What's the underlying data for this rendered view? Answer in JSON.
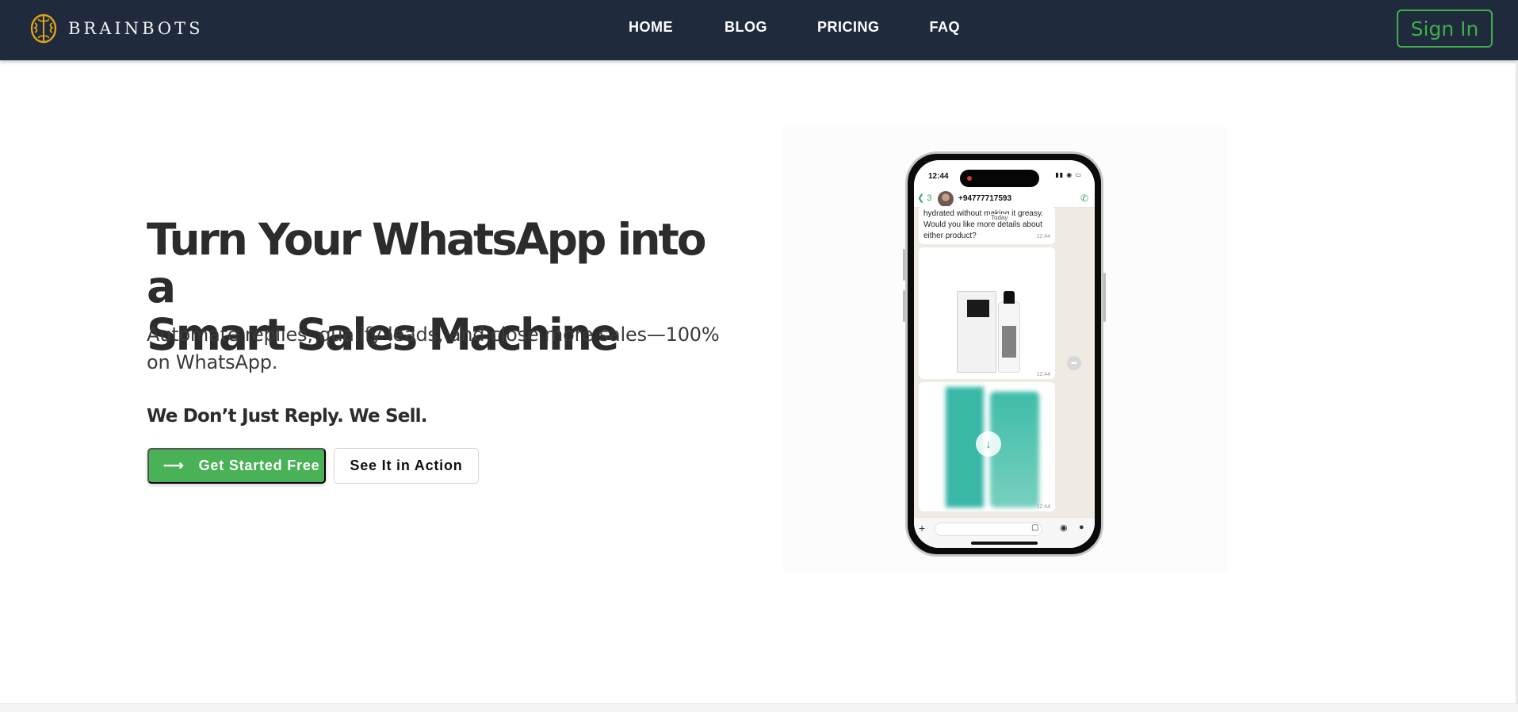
{
  "nav": {
    "brand": "BRAINBOTS",
    "menu": [
      "HOME",
      "BLOG",
      "PRICING",
      "FAQ"
    ],
    "signin_label": "Sign In"
  },
  "hero": {
    "title_line1": "Turn Your WhatsApp into a",
    "title_line2": "Smart Sales Machine",
    "subtitle": "Automate replies, qualify leads, and close more sales—100% on WhatsApp.",
    "tagline": "We Don’t Just Reply. We Sell.",
    "primary_cta": "Get Started Free",
    "secondary_cta": "See It in Action"
  },
  "phone": {
    "time": "12:44",
    "back_count": "3",
    "contact": "+94777717593",
    "message_text": "hydrated without making it greasy. Would you like more details about either product?",
    "date_chip": "Today",
    "msg_time": "12:44",
    "img1_time": "12:44",
    "img2_time": "12:44"
  },
  "colors": {
    "nav_bg": "#1f2a3c",
    "accent_green": "#49b156",
    "signin_green": "#3fae4b",
    "brand_gold": "#e0a21b"
  },
  "icons": [
    "brain-logo-icon",
    "arrow-right-icon",
    "chevron-left-icon",
    "phone-call-icon",
    "forward-icon",
    "download-icon",
    "plus-icon",
    "sticker-icon",
    "camera-icon",
    "mic-icon"
  ]
}
